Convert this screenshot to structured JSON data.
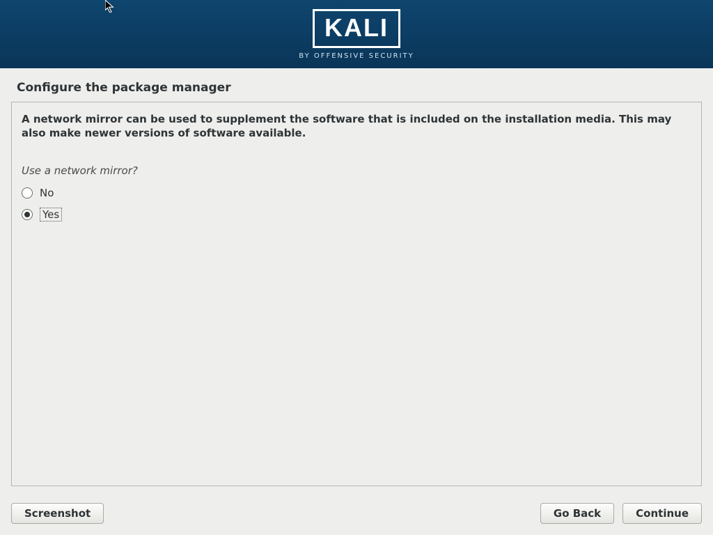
{
  "banner": {
    "logo_text": "KALI",
    "logo_sub": "BY OFFENSIVE SECURITY"
  },
  "page": {
    "title": "Configure the package manager",
    "description": "A network mirror can be used to supplement the software that is included on the installation media. This may also make newer versions of software available.",
    "question": "Use a network mirror?"
  },
  "options": {
    "no_label": "No",
    "yes_label": "Yes",
    "selected": "yes"
  },
  "buttons": {
    "screenshot": "Screenshot",
    "go_back": "Go Back",
    "continue": "Continue"
  }
}
